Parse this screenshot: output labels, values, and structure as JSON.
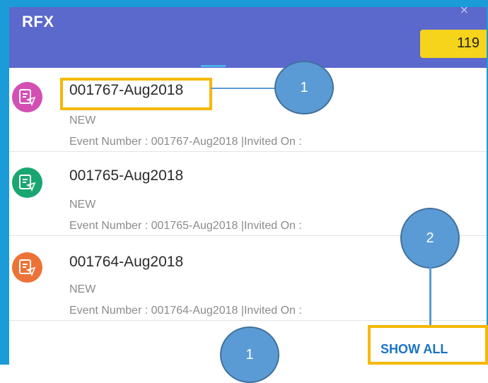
{
  "header": {
    "title": "RFX",
    "close": "×",
    "count": "119"
  },
  "items": [
    {
      "title": "001767-Aug2018",
      "status": "NEW",
      "desc": "Event Number : 001767-Aug2018 |Invited On :",
      "color": "#d44fb3"
    },
    {
      "title": "001765-Aug2018",
      "status": "NEW",
      "desc": "Event Number : 001765-Aug2018 |Invited On :",
      "color": "#1aa672"
    },
    {
      "title": "001764-Aug2018",
      "status": "NEW",
      "desc": "Event Number : 001764-Aug2018 |Invited On :",
      "color": "#ec7337"
    }
  ],
  "show_all": "SHOW ALL",
  "callouts": {
    "c1": "1",
    "c2": "2",
    "c3": "1"
  },
  "colors": {
    "header": "#5b68cc",
    "badge": "#f6d41c",
    "highlight": "#f5b800",
    "callout": "#5b9bd5",
    "link": "#1a73c8"
  }
}
